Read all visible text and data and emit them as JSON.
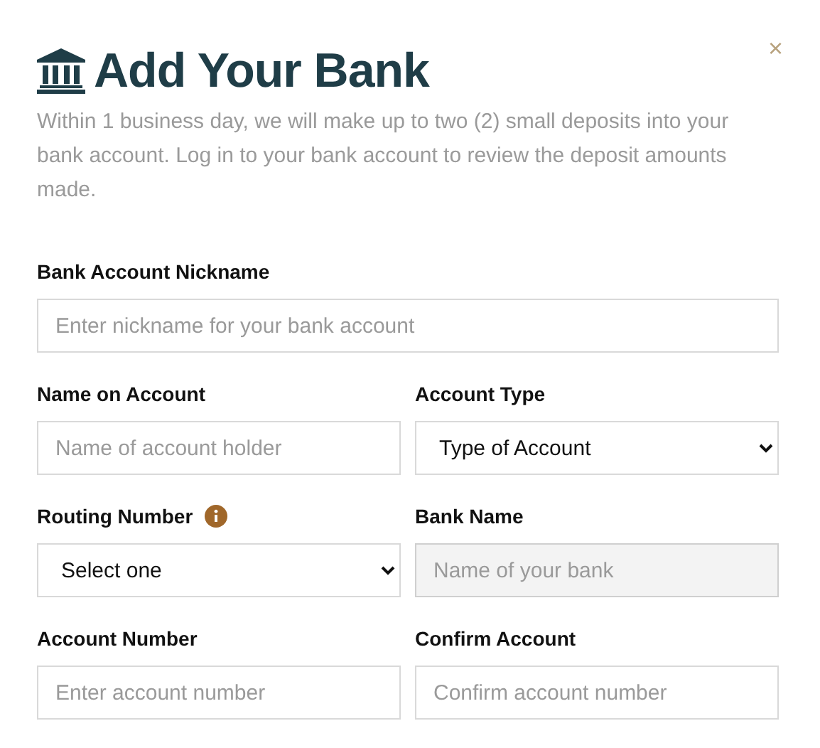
{
  "dialog": {
    "title": "Add Your Bank",
    "close": "×",
    "description": "Within 1 business day, we will make up to two (2) small deposits into your bank account. Log in to your bank account to review the deposit amounts made."
  },
  "rows": [
    [
      {
        "label": "Bank Account Nickname",
        "kind": "input",
        "placeholder": "Enter nickname for your bank account",
        "disabled": false
      }
    ],
    [
      {
        "label": "Name on Account",
        "kind": "input",
        "placeholder": "Name of account holder",
        "disabled": false
      },
      {
        "label": "Account Type",
        "kind": "select",
        "value": "Type of Account",
        "disabled": false
      }
    ],
    [
      {
        "label": "Routing Number",
        "kind": "select",
        "value": "Select one",
        "disabled": false,
        "info": true
      },
      {
        "label": "Bank Name",
        "kind": "input",
        "placeholder": "Name of your bank",
        "disabled": true
      }
    ],
    [
      {
        "label": "Account Number",
        "kind": "input",
        "placeholder": "Enter account number",
        "disabled": false
      },
      {
        "label": "Confirm Account",
        "kind": "input",
        "placeholder": "Confirm account number",
        "disabled": false
      }
    ]
  ]
}
